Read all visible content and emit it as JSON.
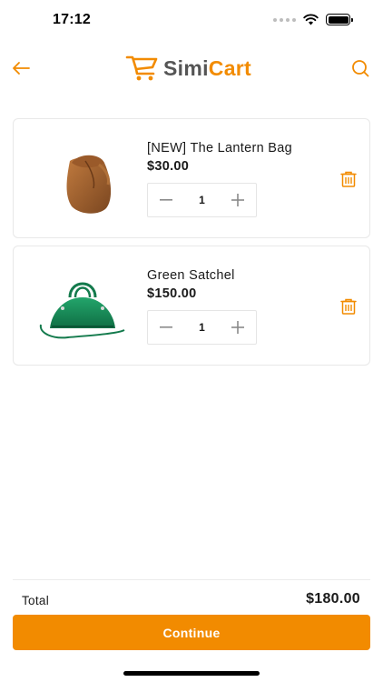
{
  "status_bar": {
    "time": "17:12"
  },
  "header": {
    "logo": {
      "part1": "Simi",
      "part2": "Cart"
    },
    "back_icon": "arrow-left-icon",
    "search_icon": "search-icon"
  },
  "cart": {
    "items": [
      {
        "name": "[NEW] The Lantern Bag",
        "price": "$30.00",
        "quantity": "1",
        "image": "brown-bucket-bag"
      },
      {
        "name": "Green Satchel",
        "price": "$150.00",
        "quantity": "1",
        "image": "green-satchel-bag"
      }
    ]
  },
  "footer": {
    "total_label": "Total",
    "total_value": "$180.00",
    "continue_label": "Continue"
  },
  "colors": {
    "accent": "#f28b00",
    "text": "#1a1a1a",
    "border": "#e8e8e8"
  }
}
